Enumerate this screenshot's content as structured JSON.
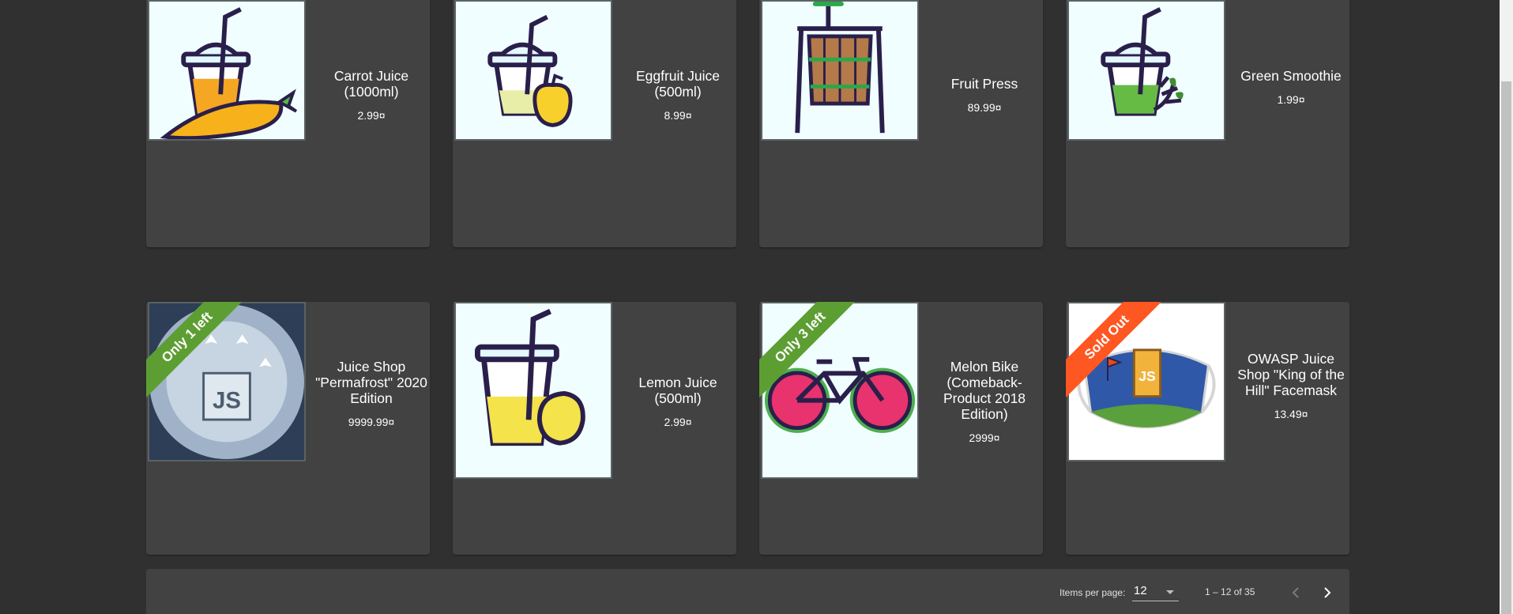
{
  "products": [
    {
      "name": "Carrot Juice (1000ml)",
      "price": "2.99¤",
      "icon": "carrot-juice-image"
    },
    {
      "name": "Eggfruit Juice (500ml)",
      "price": "8.99¤",
      "icon": "eggfruit-juice-image"
    },
    {
      "name": "Fruit Press",
      "price": "89.99¤",
      "icon": "fruit-press-image"
    },
    {
      "name": "Green Smoothie",
      "price": "1.99¤",
      "icon": "green-smoothie-image"
    },
    {
      "name": "Juice Shop \"Permafrost\" 2020 Edition",
      "price": "9999.99¤",
      "ribbon": "Only 1 left",
      "icon": "permafrost-coin-image"
    },
    {
      "name": "Lemon Juice (500ml)",
      "price": "2.99¤",
      "icon": "lemon-juice-image"
    },
    {
      "name": "Melon Bike (Comeback-Product 2018 Edition)",
      "price": "2999¤",
      "ribbon": "Only 3 left",
      "icon": "melon-bike-image"
    },
    {
      "name": "OWASP Juice Shop \"King of the Hill\" Facemask",
      "price": "13.49¤",
      "ribbon": "Sold Out",
      "icon": "facemask-image"
    }
  ],
  "ribbon_colors": {
    "stock": "#5d9e33",
    "sold_out": "#ff5722"
  },
  "paginator": {
    "items_per_page_label": "Items per page:",
    "items_per_page_value": "12",
    "range_label": "1 – 12 of 35",
    "prev_icon": "chevron-left-icon",
    "next_icon": "chevron-right-icon"
  }
}
